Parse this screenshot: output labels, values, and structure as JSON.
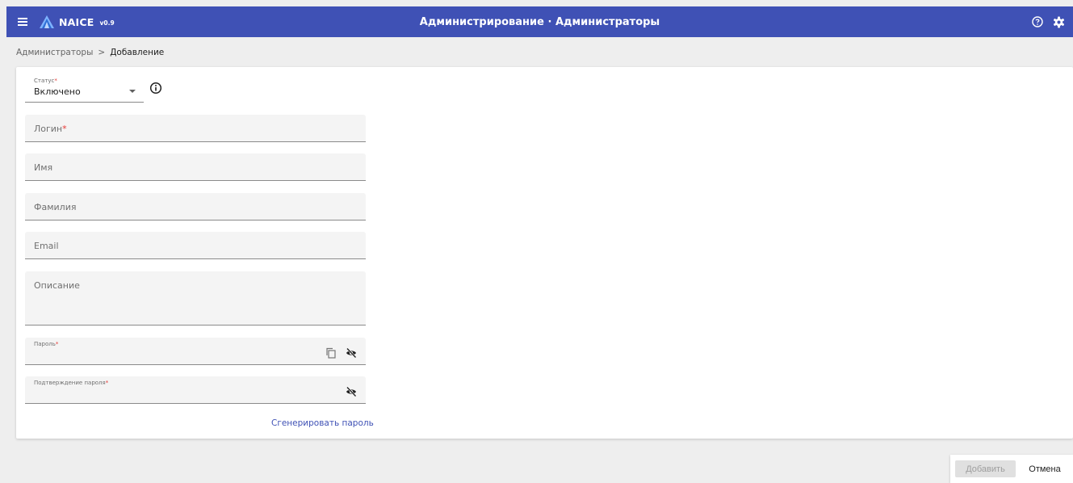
{
  "app": {
    "name": "NAICE",
    "version": "v0.9",
    "page_title": "Администрирование · Администраторы",
    "accent_color": "#3f51b5"
  },
  "header": {
    "icons": [
      "menu-icon",
      "naice-logo-icon",
      "help-icon",
      "gear-icon"
    ]
  },
  "breadcrumb": {
    "parent": "Администраторы",
    "separator": ">",
    "current": "Добавление"
  },
  "form": {
    "status": {
      "label": "Статус",
      "required_mark": "*",
      "value": "Включено"
    },
    "login": {
      "label": "Логин",
      "required_mark": "*",
      "value": ""
    },
    "first_name": {
      "label": "Имя",
      "value": ""
    },
    "last_name": {
      "label": "Фамилия",
      "value": ""
    },
    "email": {
      "label": "Email",
      "value": ""
    },
    "description": {
      "label": "Описание",
      "value": ""
    },
    "password": {
      "label": "Пароль",
      "required_mark": "*",
      "value": ""
    },
    "password_confirm": {
      "label": "Подтверждение пароля",
      "required_mark": "*",
      "value": ""
    },
    "generate_link": "Сгенерировать пароль"
  },
  "actions": {
    "add_label": "Добавить",
    "cancel_label": "Отмена"
  }
}
